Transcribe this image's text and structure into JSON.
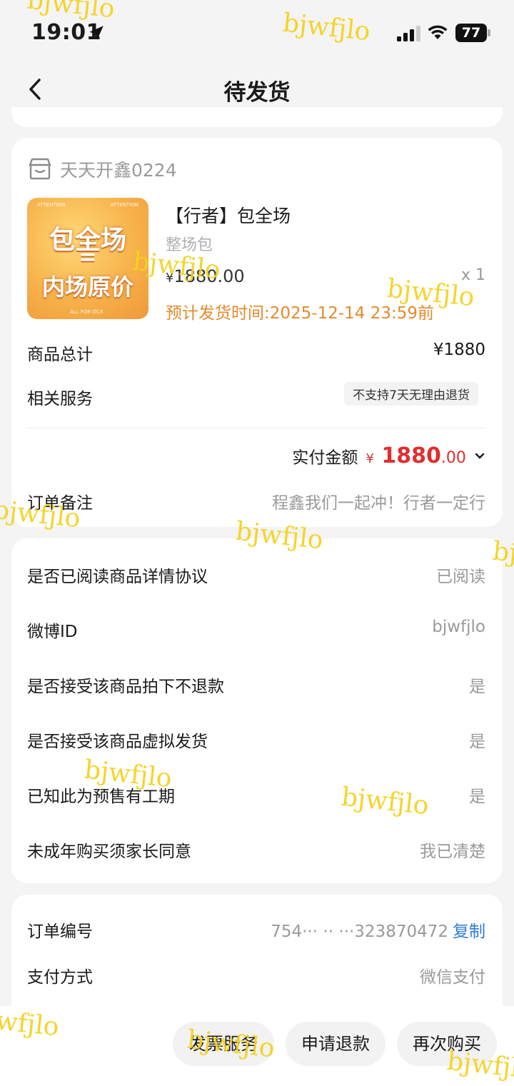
{
  "status_bar": {
    "time": "19:01",
    "battery": "77",
    "icons": [
      "location-arrow-icon",
      "signal-icon",
      "wifi-icon",
      "battery-icon"
    ]
  },
  "nav": {
    "title": "待发货",
    "back_icon": "chevron-left-icon"
  },
  "shop": {
    "name": "天天开鑫0224",
    "icon": "shop-icon"
  },
  "product": {
    "image_text": {
      "line1": "包全场",
      "line2": "=",
      "line3": "内场原价",
      "tag1": "ATTENTION",
      "tag2": "ATTENTION",
      "tag3": "ALL FOR DCX"
    },
    "title": "【行者】包全场",
    "subtitle": "整场包",
    "price_symbol": "¥",
    "price": "1880.00",
    "quantity": "x 1",
    "ship_time": "预计发货时间:2025-12-14 23:59前"
  },
  "summary": {
    "total_label": "商品总计",
    "total_value": "¥1880",
    "service_label": "相关服务",
    "service_badge": "不支持7天无理由退货",
    "paid_label": "实付金额",
    "paid_symbol": "¥",
    "paid_int": "1880",
    "paid_dec": ".00",
    "remark_label": "订单备注",
    "remark_value": "程鑫我们一起冲！行者一定行"
  },
  "info_rows": [
    {
      "label": "是否已阅读商品详情协议",
      "value": "已阅读"
    },
    {
      "label": "微博ID",
      "value": "bjwfjlo"
    },
    {
      "label": "是否接受该商品拍下不退款",
      "value": "是"
    },
    {
      "label": "是否接受该商品虚拟发货",
      "value": "是"
    },
    {
      "label": "已知此为预售有工期",
      "value": "是"
    },
    {
      "label": "未成年购买须家长同意",
      "value": "我已清楚"
    }
  ],
  "order": {
    "number_label": "订单编号",
    "number_value": "754··· ·· ···323870472",
    "copy_label": "复制",
    "pay_label": "支付方式",
    "pay_value": "微信支付"
  },
  "actions": {
    "invoice": "发票服务",
    "refund": "申请退款",
    "rebuy": "再次购买"
  },
  "watermark": "bjwfjlo",
  "colors": {
    "price_red": "#e02e2e",
    "ship_orange": "#e58a2b",
    "link_blue": "#2f7bd8",
    "watermark_yellow": "#f4d21c"
  }
}
